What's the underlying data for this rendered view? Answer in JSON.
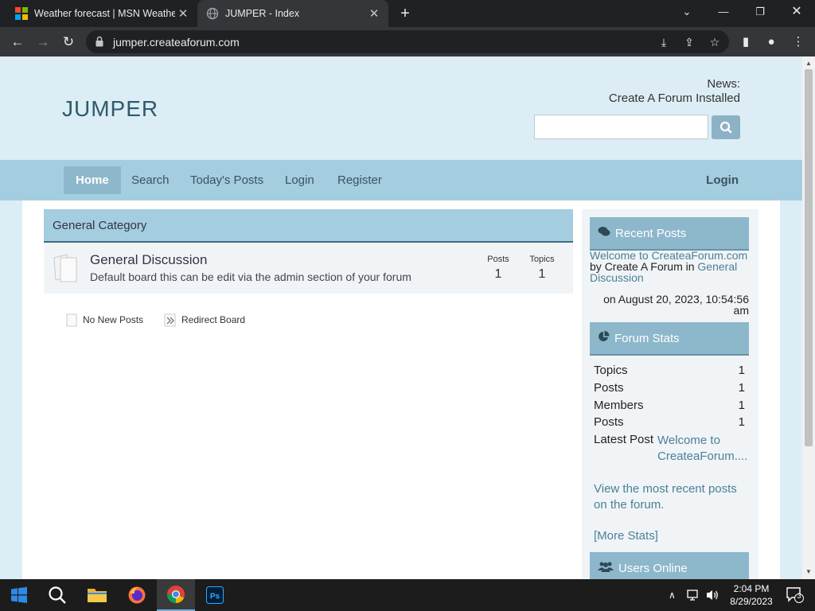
{
  "browser": {
    "tabs": [
      {
        "title": "Weather forecast | MSN Weather",
        "icon": "microsoft-logo-icon"
      },
      {
        "title": "JUMPER - Index",
        "icon": "globe-icon"
      }
    ],
    "url": "jumper.createaforum.com"
  },
  "site": {
    "logo": "JUMPER",
    "news_label": "News:",
    "news_text": "Create A Forum Installed",
    "search_placeholder": ""
  },
  "nav": {
    "items": [
      "Home",
      "Search",
      "Today's Posts",
      "Login",
      "Register"
    ],
    "active": "Home",
    "right_login": "Login"
  },
  "category": {
    "title": "General Category",
    "boards": [
      {
        "name": "General Discussion",
        "description": "Default board this can be edit via the admin section of your forum",
        "posts_label": "Posts",
        "posts": "1",
        "topics_label": "Topics",
        "topics": "1"
      }
    ]
  },
  "legend": {
    "no_new_posts": "No New Posts",
    "redirect_board": "Redirect Board"
  },
  "sidebar": {
    "recent_posts": {
      "title": "Recent Posts",
      "post_title": "Welcome to CreateaForum.com",
      "by": "by",
      "author": "Create A Forum",
      "in": "in",
      "board": "General Discussion",
      "date": "on August 20, 2023, 10:54:56 am"
    },
    "forum_stats": {
      "title": "Forum Stats",
      "rows": [
        {
          "label": "Topics",
          "value": "1"
        },
        {
          "label": "Posts",
          "value": "1"
        },
        {
          "label": "Members",
          "value": "1"
        },
        {
          "label": "Posts",
          "value": "1"
        }
      ],
      "latest_label": "Latest Post",
      "latest_link": "Welcome to CreateaForum....",
      "note": "View the most recent posts on the forum.",
      "more": "[More Stats]"
    },
    "users_online": {
      "title": "Users Online"
    }
  },
  "taskbar": {
    "time": "2:04 PM",
    "date": "8/29/2023",
    "notifications": "3"
  },
  "colors": {
    "header_bg": "#dcedf5",
    "nav_bg": "#a5cde0",
    "accent": "#8db7cb",
    "link": "#4c7f98"
  }
}
